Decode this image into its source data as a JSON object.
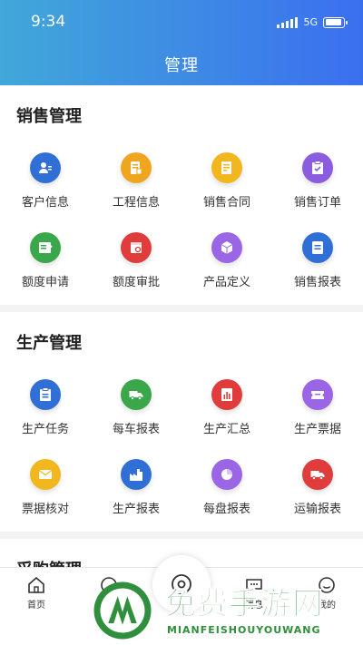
{
  "status_bar": {
    "time": "9:34",
    "network": "5G"
  },
  "header": {
    "title": "管理"
  },
  "sections": [
    {
      "title": "销售管理",
      "items": [
        {
          "label": "客户信息",
          "icon": "customer-icon",
          "color": "#2f6fd6"
        },
        {
          "label": "工程信息",
          "icon": "project-icon",
          "color": "#f0a51f"
        },
        {
          "label": "销售合同",
          "icon": "contract-icon",
          "color": "#f2b71e"
        },
        {
          "label": "销售订单",
          "icon": "order-icon",
          "color": "#8b5be0"
        },
        {
          "label": "额度申请",
          "icon": "apply-icon",
          "color": "#3aa74a"
        },
        {
          "label": "额度审批",
          "icon": "approve-icon",
          "color": "#e03c3c"
        },
        {
          "label": "产品定义",
          "icon": "product-icon",
          "color": "#9a66e6"
        },
        {
          "label": "销售报表",
          "icon": "report-icon",
          "color": "#2f6fd6"
        }
      ]
    },
    {
      "title": "生产管理",
      "items": [
        {
          "label": "生产任务",
          "icon": "task-icon",
          "color": "#2f6fd6"
        },
        {
          "label": "每车报表",
          "icon": "truck-icon",
          "color": "#3aa74a"
        },
        {
          "label": "生产汇总",
          "icon": "summary-icon",
          "color": "#e03c3c"
        },
        {
          "label": "生产票据",
          "icon": "ticket-icon",
          "color": "#9a66e6"
        },
        {
          "label": "票据核对",
          "icon": "mail-icon",
          "color": "#f2b71e"
        },
        {
          "label": "生产报表",
          "icon": "factory-icon",
          "color": "#2f6fd6"
        },
        {
          "label": "每盘报表",
          "icon": "pie-icon",
          "color": "#9a66e6"
        },
        {
          "label": "运输报表",
          "icon": "transport-icon",
          "color": "#e03c3c"
        }
      ]
    },
    {
      "title": "采购管理",
      "items": []
    }
  ],
  "tabbar": {
    "tabs": [
      {
        "label": "首页",
        "icon": "home-icon"
      },
      {
        "label": "",
        "icon": "apps-icon"
      },
      {
        "label": "",
        "icon": "camera-icon"
      },
      {
        "label": "消息",
        "icon": "chat-icon"
      },
      {
        "label": "我的",
        "icon": "user-icon"
      }
    ]
  },
  "watermark": {
    "text": "免费手游网",
    "subtext": "MIANFEISHOUYOUWANG"
  }
}
